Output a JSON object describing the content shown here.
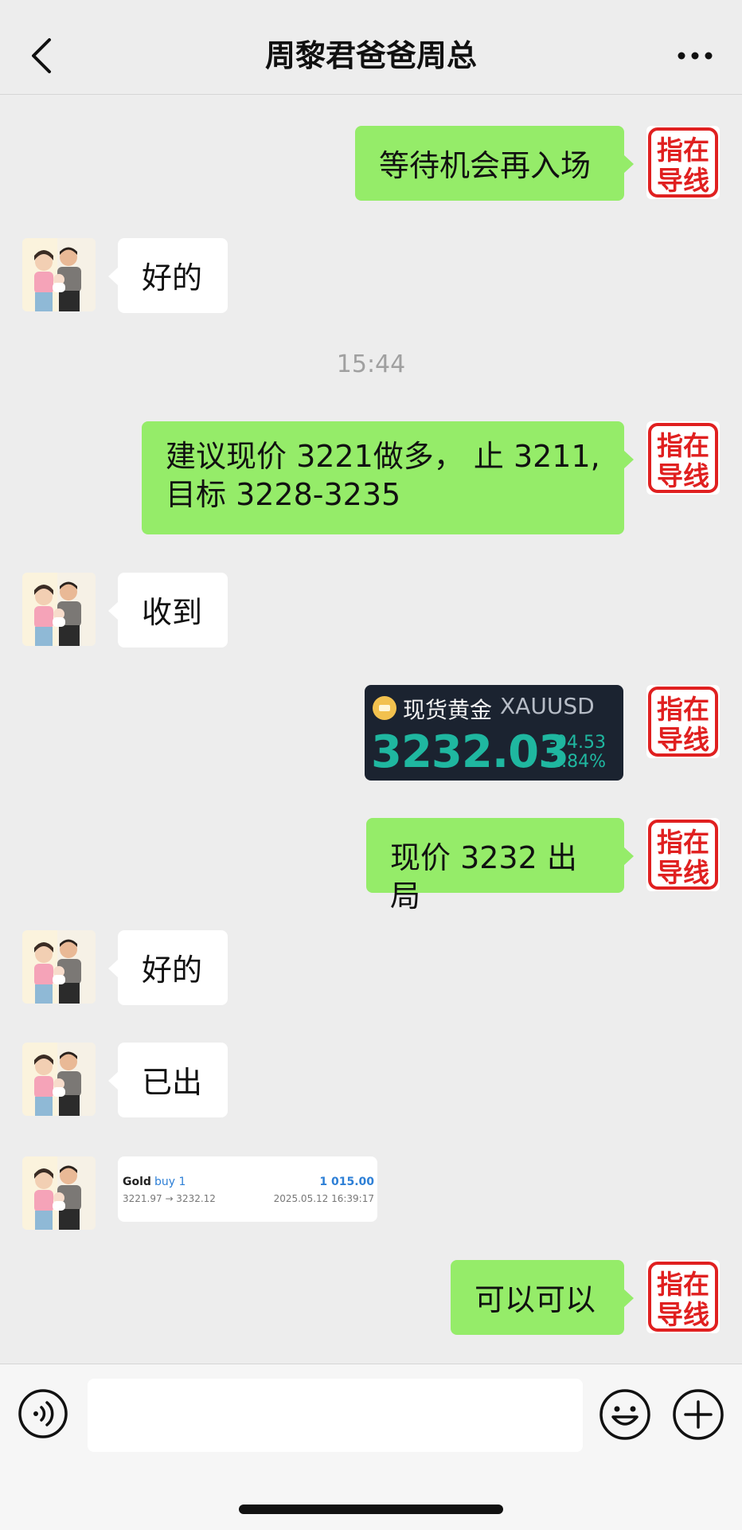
{
  "header": {
    "title": "周黎君爸爸周总"
  },
  "self_avatar": {
    "text_top": "指在",
    "text_bottom": "导线",
    "color": "#e02020"
  },
  "messages": {
    "m1": "等待机会再入场",
    "m2": "好的",
    "timestamp": "15:44",
    "m3_line1": "建议现价 3221做多， 止 3211,",
    "m3_line2": "目标 3228-3235",
    "m4": "收到",
    "m6": "现价 3232 出局",
    "m7": "好的",
    "m8": "已出",
    "m10": "可以可以"
  },
  "gold_card": {
    "name": "现货黄金",
    "symbol": "XAUUSD",
    "price": "3232.03",
    "change": "-94.53",
    "change_pct": "-2.84%",
    "accent": "#1fb7a0"
  },
  "trade_card": {
    "symbol": "Gold",
    "direction": "buy 1",
    "profit": "1 015.00",
    "range": "3221.97 → 3232.12",
    "time": "2025.05.12 16:39:17"
  },
  "input": {
    "value": ""
  },
  "colors": {
    "self_bubble": "#95ec69",
    "other_bubble": "#ffffff",
    "background": "#ededed"
  }
}
